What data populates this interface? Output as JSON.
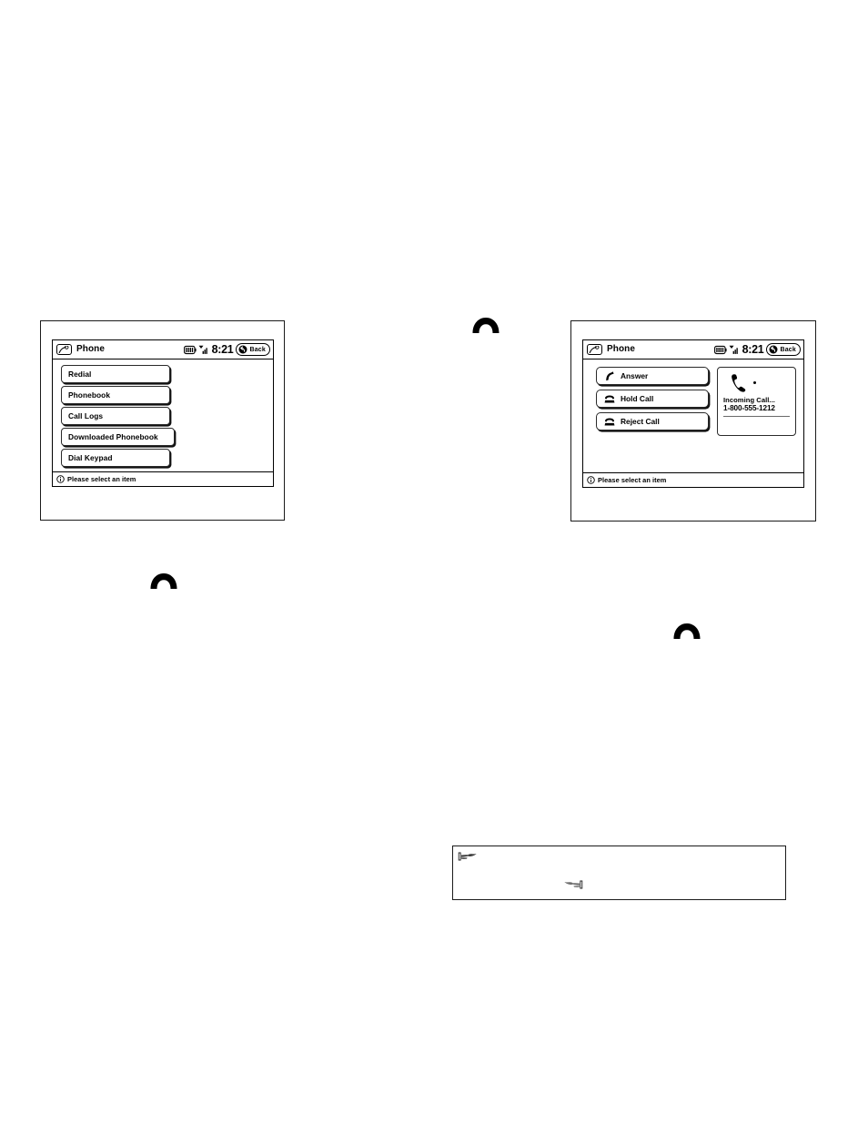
{
  "page": {
    "kind": "vehicle-infotainment-manual-figure"
  },
  "screens": [
    {
      "id": "phone-menu",
      "titlebar": {
        "app_icon": "phone-handset-icon",
        "title": "Phone",
        "battery_icon": "battery-icon",
        "signal_icon": "signal-bars-icon",
        "clock": "8:21",
        "back_icon": "back-arrow-icon",
        "back_label": "Back"
      },
      "menu_items": [
        {
          "label": "Redial",
          "icon": "",
          "wide": false
        },
        {
          "label": "Phonebook",
          "icon": "",
          "wide": false
        },
        {
          "label": "Call Logs",
          "icon": "",
          "wide": false
        },
        {
          "label": "Downloaded Phonebook",
          "icon": "",
          "wide": true
        },
        {
          "label": "Dial Keypad",
          "icon": "",
          "wide": false
        }
      ],
      "hintbar": {
        "icon": "info-circle-icon",
        "text": "Please select an item"
      }
    },
    {
      "id": "incoming-call",
      "titlebar": {
        "app_icon": "phone-handset-icon",
        "title": "Phone",
        "battery_icon": "battery-icon",
        "signal_icon": "signal-bars-icon",
        "clock": "8:21",
        "back_icon": "back-arrow-icon",
        "back_label": "Back"
      },
      "actions": [
        {
          "label": "Answer",
          "icon": "curved-handset-icon"
        },
        {
          "label": "Hold Call",
          "icon": "desk-phone-icon"
        },
        {
          "label": "Reject Call",
          "icon": "desk-phone-icon"
        }
      ],
      "call_panel": {
        "glyph": "ringing-handset-icon",
        "status": "Incoming Call...",
        "number": "1-800-555-1212"
      },
      "hintbar": {
        "icon": "info-circle-icon",
        "text": "Please select an item"
      }
    }
  ],
  "markers": [
    {
      "id": "handset-1",
      "icon": "handset-marker-icon"
    },
    {
      "id": "handset-2",
      "icon": "handset-marker-icon"
    },
    {
      "id": "handset-3",
      "icon": "handset-marker-icon"
    }
  ],
  "note_box": {
    "primary_icon": "pointing-hand-right-icon",
    "secondary_icon": "pointing-hand-left-icon",
    "text": ""
  },
  "colors": {
    "ink": "#000000",
    "paper": "#ffffff",
    "rule": "#6a6a6a"
  }
}
